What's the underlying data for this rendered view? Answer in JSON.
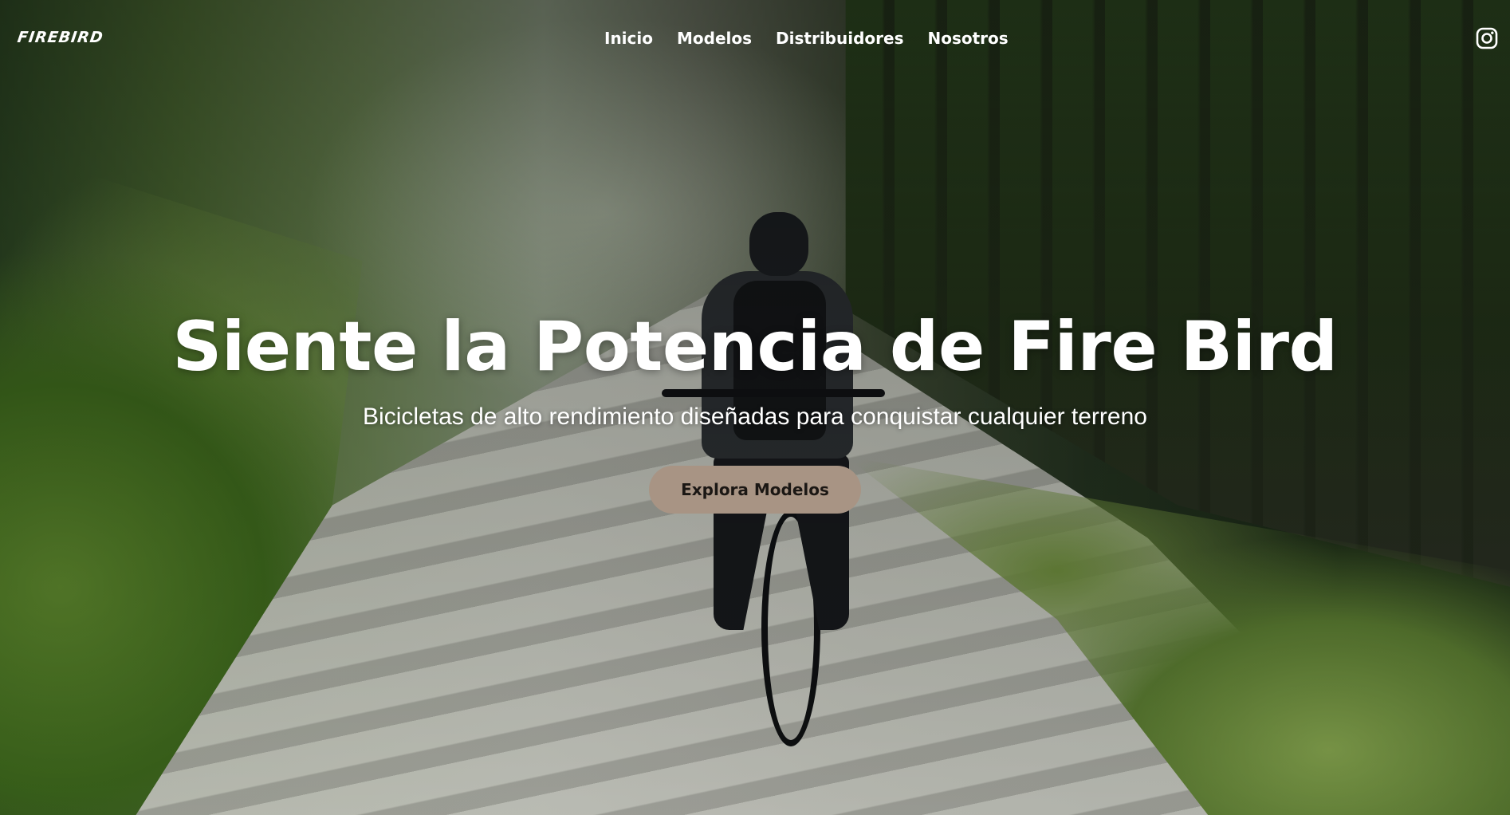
{
  "nav": {
    "logo_text": "FIREBIRD",
    "items": [
      {
        "label": "Inicio"
      },
      {
        "label": "Modelos"
      },
      {
        "label": "Distribuidores"
      },
      {
        "label": "Nosotros"
      }
    ],
    "social_icon": "instagram-icon"
  },
  "hero": {
    "headline": "Siente la Potencia de Fire Bird",
    "subtitle": "Bicicletas de alto rendimiento diseñadas para conquistar cualquier terreno",
    "cta_label": "Explora Modelos"
  },
  "colors": {
    "text": "#ffffff",
    "cta_background": "#a89484",
    "cta_text": "#1b1714"
  }
}
